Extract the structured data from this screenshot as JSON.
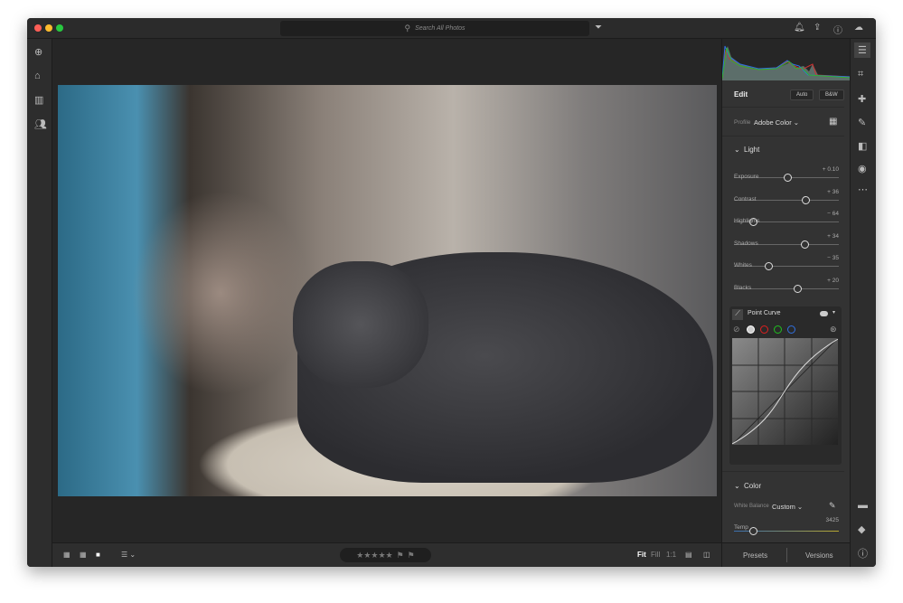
{
  "window": {
    "controls": {
      "close": "#fe5f57",
      "minimize": "#febc2e",
      "maximize": "#28c840"
    }
  },
  "topbar": {
    "search_placeholder": "Search All Photos",
    "icons": [
      "search-icon",
      "filter-icon",
      "bell-icon",
      "share-icon",
      "help-icon",
      "cloud-icon"
    ]
  },
  "left_sidebar": {
    "icons": [
      "add-icon",
      "home-icon",
      "library-icon",
      "people-icon"
    ]
  },
  "bottom_toolbar": {
    "view_icons": [
      "square-grid-icon",
      "grid-icon",
      "detail-icon"
    ],
    "sort_icon": "sort-icon",
    "stars": "★★★★★",
    "flags": [
      "pick-flag-icon",
      "reject-flag-icon"
    ],
    "zoom": {
      "fit": "Fit",
      "fill": "Fill",
      "one": "1:1"
    }
  },
  "edit_panel": {
    "title": "Edit",
    "auto": "Auto",
    "bw": "B&W",
    "profile_label": "Profile",
    "profile_value": "Adobe Color",
    "light": {
      "title": "Light",
      "sliders": [
        {
          "label": "Exposure",
          "value": "+ 0.10",
          "pos": 0.51
        },
        {
          "label": "Contrast",
          "value": "+ 36",
          "pos": 0.68
        },
        {
          "label": "Highlights",
          "value": "− 64",
          "pos": 0.18
        },
        {
          "label": "Shadows",
          "value": "+ 34",
          "pos": 0.67
        },
        {
          "label": "Whites",
          "value": "− 35",
          "pos": 0.33
        },
        {
          "label": "Blacks",
          "value": "+ 20",
          "pos": 0.6
        }
      ]
    },
    "curve": {
      "title": "Point Curve",
      "channels": [
        "#ffffff",
        "#e02020",
        "#20c020",
        "#3070e0"
      ]
    },
    "color": {
      "title": "Color",
      "wb_label": "White Balance",
      "wb_value": "Custom",
      "temp_label": "Temp",
      "temp_value": "3425",
      "temp_pos": 0.18
    },
    "tabs": {
      "presets": "Presets",
      "versions": "Versions"
    }
  },
  "right_strip": {
    "icons": [
      "edit-sliders-icon",
      "crop-icon",
      "healing-icon",
      "brush-icon",
      "linear-gradient-icon",
      "radial-gradient-icon",
      "more-icon",
      "comment-icon",
      "tag-icon",
      "info-icon"
    ]
  }
}
